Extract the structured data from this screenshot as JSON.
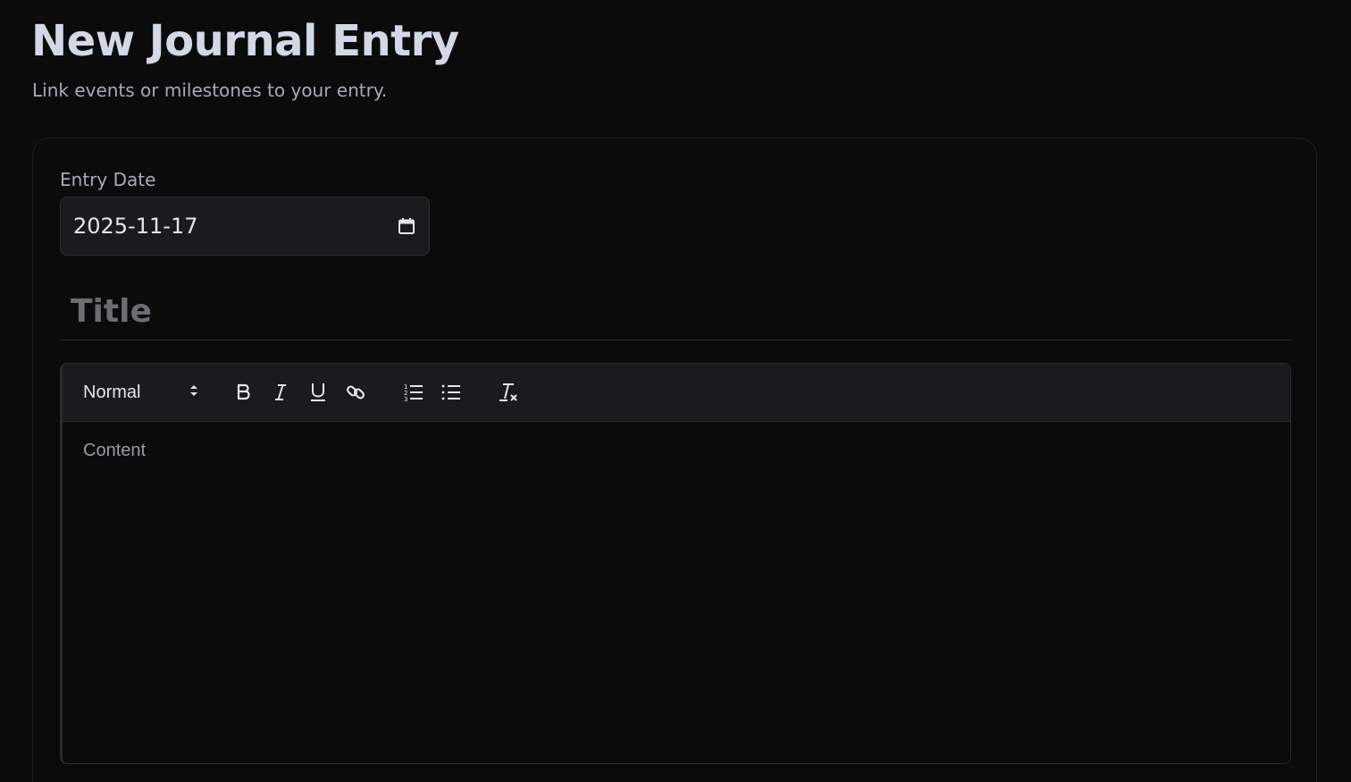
{
  "header": {
    "title": "New Journal Entry",
    "subtitle": "Link events or milestones to your entry."
  },
  "form": {
    "date_label": "Entry Date",
    "date_value": "2025-11-17",
    "title_placeholder": "Title",
    "editor": {
      "header_select_value": "Normal",
      "content_placeholder": "Content",
      "toolbar_icons": [
        "bold-icon",
        "italic-icon",
        "underline-icon",
        "link-icon",
        "ordered-list-icon",
        "bullet-list-icon",
        "clear-format-icon"
      ]
    }
  },
  "colors": {
    "background": "#0b0b0c",
    "title": "#d3d8e6",
    "muted_text": "#a7abb5",
    "field_background": "#1b1b1e",
    "border": "#2a2b2f",
    "placeholder": "#6c6d72"
  }
}
